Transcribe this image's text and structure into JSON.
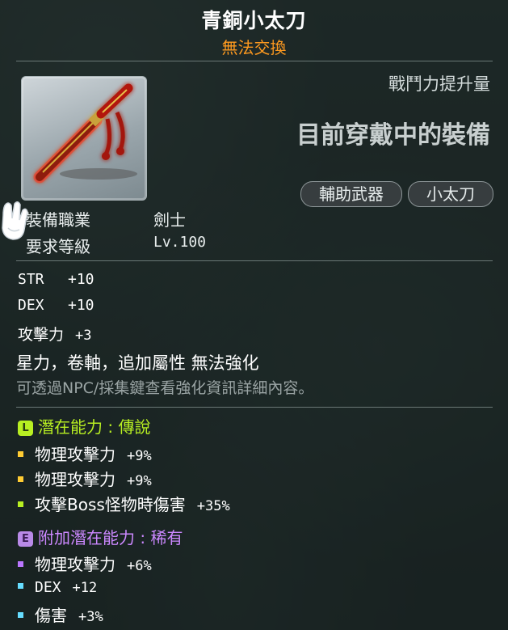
{
  "item": {
    "name": "青銅小太刀",
    "trade_status": "無法交換",
    "power_label": "戰鬥力提升量",
    "equipped_status": "目前穿戴中的裝備",
    "tags": [
      "輔助武器",
      "小太刀"
    ]
  },
  "requirements": {
    "job_label": "裝備職業",
    "job_value": "劍士",
    "level_label": "要求等級",
    "level_value": "Lv.100"
  },
  "stats": [
    {
      "name": "STR",
      "value": "+10"
    },
    {
      "name": "DEX",
      "value": "+10"
    }
  ],
  "attack": {
    "name": "攻擊力",
    "value": "+3"
  },
  "notes": {
    "enhance": "星力，卷軸，追加屬性 無法強化",
    "hint": "可透過NPC/採集鍵查看強化資訊詳細內容。"
  },
  "potential": {
    "badge": "L",
    "title": "潛在能力 : 傳說",
    "color": "#b8ef22",
    "lines": [
      {
        "name": "物理攻擊力",
        "value": "+9%",
        "bullet_color": "#ffcc33"
      },
      {
        "name": "物理攻擊力",
        "value": "+9%",
        "bullet_color": "#ffcc33"
      },
      {
        "name": "攻擊Boss怪物時傷害",
        "value": "+35%",
        "bullet_color": "#b8ef22"
      }
    ]
  },
  "bonus_potential": {
    "badge": "E",
    "title": "附加潛在能力 : 稀有",
    "color": "#cc88ff",
    "lines": [
      {
        "name": "物理攻擊力",
        "value": "+6%",
        "bullet_color": "#bb77ff"
      },
      {
        "name": "DEX",
        "value": "+12",
        "bullet_color": "#66ddff"
      },
      {
        "name": "傷害",
        "value": "+3%",
        "bullet_color": "#66ddff"
      }
    ]
  }
}
